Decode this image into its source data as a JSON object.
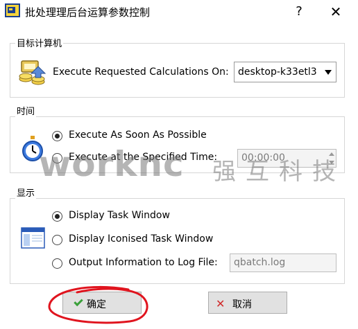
{
  "window": {
    "title": "批处理理后台运算参数控制",
    "help_label": "?",
    "close_label": "✕"
  },
  "target_group": {
    "title": "目标计算机",
    "execute_on_label": "Execute Requested Calculations On:",
    "computer_value": "desktop-k33etl3"
  },
  "time_group": {
    "title": "时间",
    "option_asap": "Execute As Soon As Possible",
    "option_specified": "Execute at the Specified Time:",
    "time_value": "00:00:00",
    "selected": "asap"
  },
  "display_group": {
    "title": "显示",
    "option_task_window": "Display Task Window",
    "option_iconised": "Display Iconised Task Window",
    "option_log": "Output Information to Log File:",
    "log_file_value": "qbatch.log",
    "selected": "task_window"
  },
  "buttons": {
    "ok_label": "确定",
    "cancel_label": "取消"
  },
  "watermark": {
    "latin": "worknc",
    "cjk": "强互科技"
  },
  "colors": {
    "annotation": "#e0141e",
    "ok_icon": "#3aa03a",
    "cancel_icon": "#d02a2a"
  },
  "icons": {
    "app": "app-icon",
    "target_computer": "computer-coins-icon",
    "time": "stopwatch-icon",
    "display": "window-icon"
  }
}
